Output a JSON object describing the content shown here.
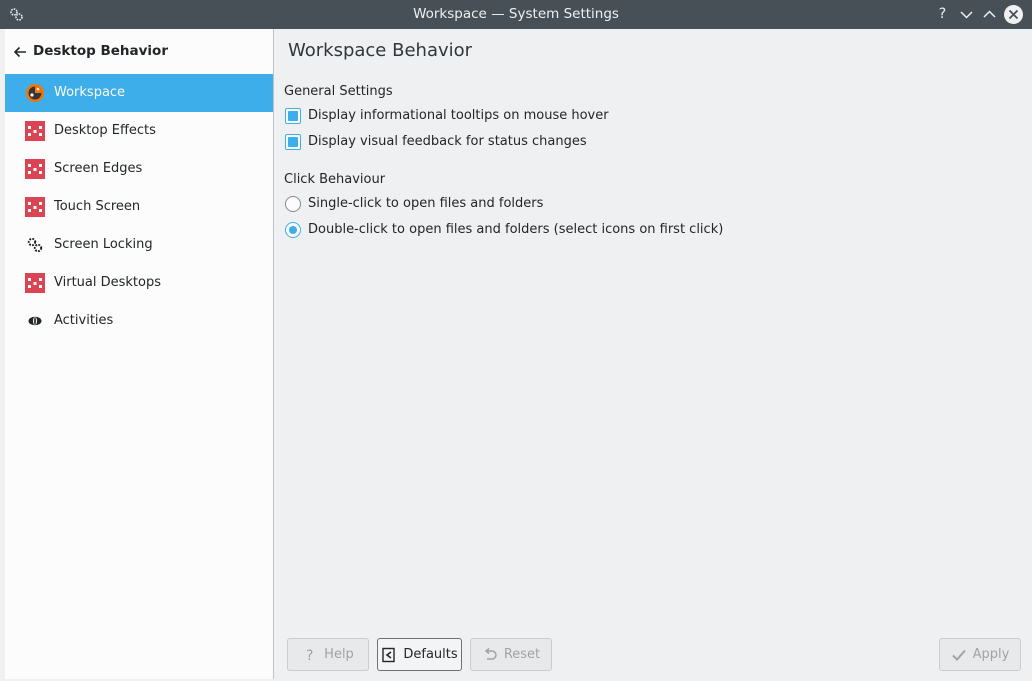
{
  "window": {
    "title": "Workspace — System Settings",
    "help_glyph": "?"
  },
  "sidebar": {
    "header": "Desktop Behavior",
    "items": [
      {
        "label": "Workspace",
        "icon": "workspace-icon",
        "selected": true
      },
      {
        "label": "Desktop Effects",
        "icon": "desktop-effects-icon"
      },
      {
        "label": "Screen Edges",
        "icon": "screen-edges-icon"
      },
      {
        "label": "Touch Screen",
        "icon": "touch-screen-icon"
      },
      {
        "label": "Screen Locking",
        "icon": "screen-locking-icon"
      },
      {
        "label": "Virtual Desktops",
        "icon": "virtual-desktops-icon"
      },
      {
        "label": "Activities",
        "icon": "activities-icon"
      }
    ]
  },
  "main": {
    "title": "Workspace Behavior",
    "general": {
      "label": "General Settings",
      "options": [
        {
          "label": "Display informational tooltips on mouse hover",
          "checked": true
        },
        {
          "label": "Display visual feedback for status changes",
          "checked": true
        }
      ]
    },
    "click": {
      "label": "Click Behaviour",
      "options": [
        {
          "label": "Single-click to open files and folders",
          "selected": false
        },
        {
          "label": "Double-click to open files and folders (select icons on first click)",
          "selected": true
        }
      ]
    }
  },
  "buttons": {
    "help": "Help",
    "defaults": "Defaults",
    "reset": "Reset",
    "apply": "Apply"
  },
  "colors": {
    "accent": "#3daee9",
    "titlebar": "#475057",
    "icon_red": "#da4453",
    "icon_orange": "#f67400"
  }
}
